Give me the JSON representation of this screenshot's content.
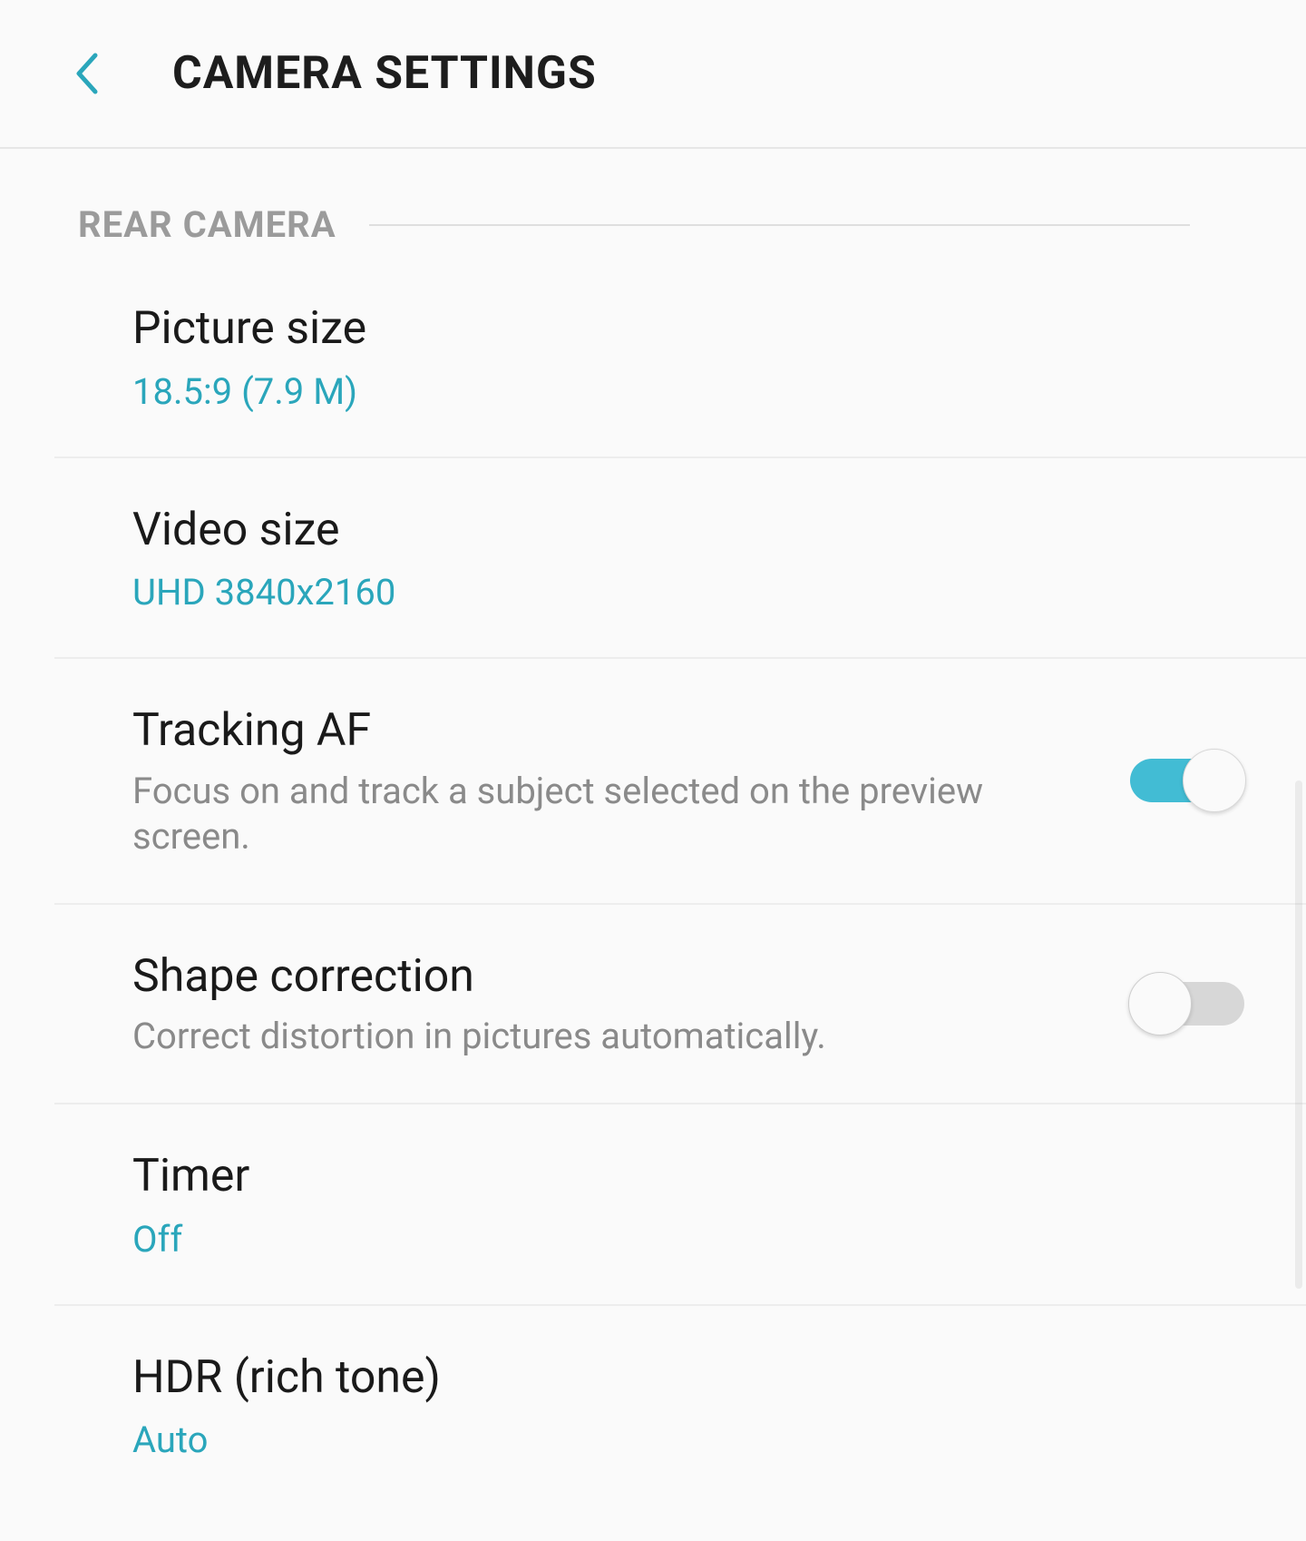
{
  "header": {
    "title": "CAMERA SETTINGS"
  },
  "section": {
    "label": "REAR CAMERA"
  },
  "rows": {
    "picture_size": {
      "title": "Picture size",
      "value": "18.5:9 (7.9 M)"
    },
    "video_size": {
      "title": "Video size",
      "value": "UHD 3840x2160"
    },
    "tracking_af": {
      "title": "Tracking AF",
      "desc": "Focus on and track a subject selected on the preview screen.",
      "toggle": true
    },
    "shape_correction": {
      "title": "Shape correction",
      "desc": "Correct distortion in pictures automatically.",
      "toggle": false
    },
    "timer": {
      "title": "Timer",
      "value": "Off"
    },
    "hdr": {
      "title": "HDR (rich tone)",
      "value": "Auto"
    }
  },
  "colors": {
    "accent": "#2aa6bb",
    "toggle_on": "#42bcd4"
  }
}
